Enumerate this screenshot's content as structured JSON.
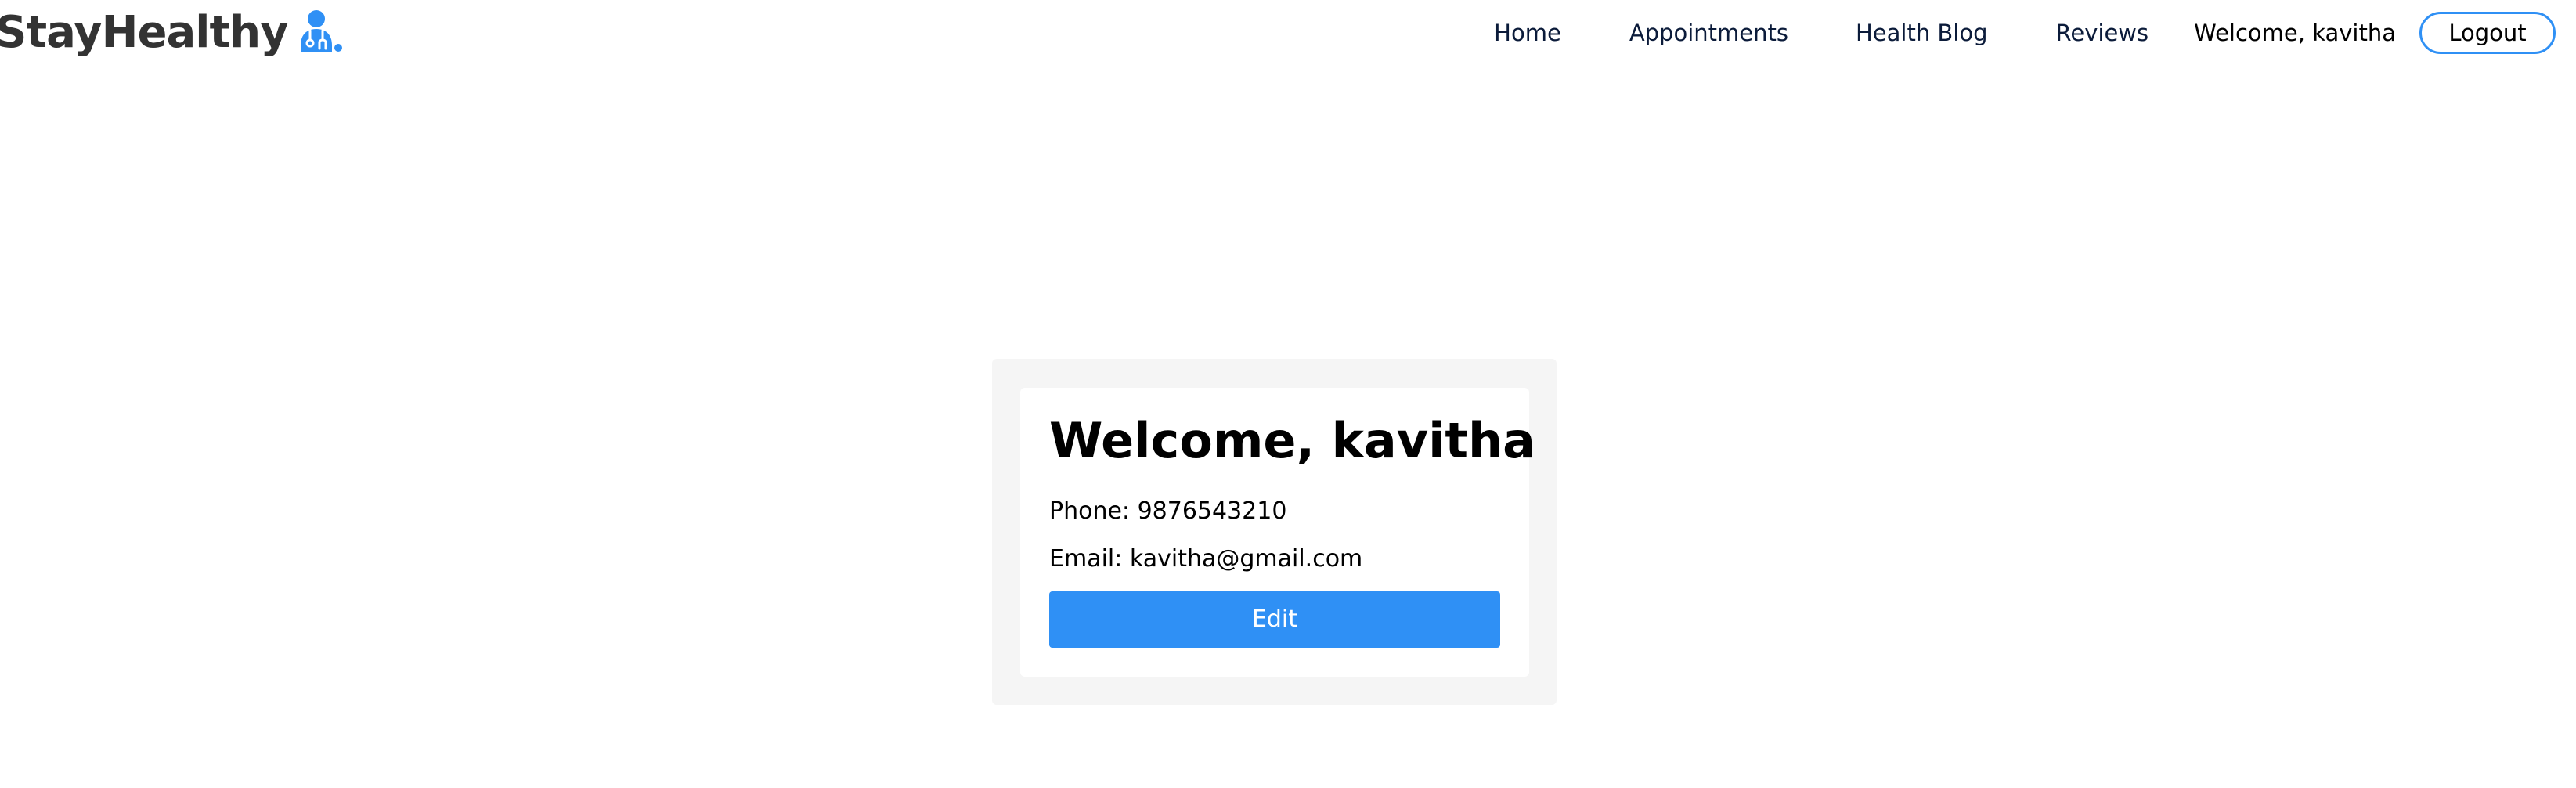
{
  "brand": {
    "name": "StayHealthy",
    "logo_icon": "doctor-icon",
    "accent_color": "#2f90f5"
  },
  "nav": {
    "items": [
      {
        "label": "Home"
      },
      {
        "label": "Appointments"
      },
      {
        "label": "Health Blog"
      },
      {
        "label": "Reviews"
      }
    ],
    "welcome": "Welcome, kavitha",
    "logout_label": "Logout"
  },
  "profile": {
    "title": "Welcome, kavitha",
    "phone": "Phone: 9876543210",
    "email": "Email: kavitha@gmail.com",
    "edit_label": "Edit",
    "button_color": "#2f90f5",
    "panel_color": "#f5f5f5"
  }
}
